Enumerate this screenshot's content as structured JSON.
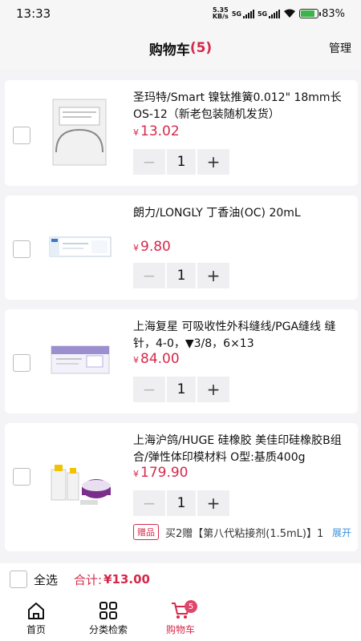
{
  "status": {
    "time": "13:33",
    "speed_value": "5.35",
    "speed_unit": "KB/s",
    "net_a": "5G",
    "net_b": "5G",
    "battery": "83%"
  },
  "header": {
    "title": "购物车",
    "count": "(5)",
    "manage": "管理"
  },
  "currency": "¥",
  "items": [
    {
      "title": "圣玛特/Smart 镍钛推簧0.012\" 18mm长OS-12（新老包装随机发货）",
      "price": "13.02",
      "qty": "1",
      "minus": "−",
      "plus": "+"
    },
    {
      "title": "朗力/LONGLY 丁香油(OC) 20mL",
      "price": "9.80",
      "qty": "1",
      "minus": "−",
      "plus": "+"
    },
    {
      "title": "上海复星 可吸收性外科缝线/PGA缝线 缝针，4-0，▼3/8，6×13",
      "price": "84.00",
      "qty": "1",
      "minus": "−",
      "plus": "+"
    },
    {
      "title": "上海沪鸽/HUGE 硅橡胶 美佳印硅橡胶B组合/弹性体印模材料 O型:基质400g",
      "price": "179.90",
      "qty": "1",
      "minus": "−",
      "plus": "+",
      "gift": {
        "badge": "赠品",
        "text": "买2赠【第八代粘接剂(1.5mL)】1",
        "expand": "展开"
      }
    }
  ],
  "footer": {
    "select_all": "全选",
    "total_label": "合计:",
    "total_value": "¥13.00"
  },
  "tabs": [
    {
      "label": "首页",
      "icon": "home-icon"
    },
    {
      "label": "分类检索",
      "icon": "grid-icon"
    },
    {
      "label": "购物车",
      "icon": "cart-icon",
      "badge": "5",
      "active": true
    }
  ],
  "colors": {
    "accent": "#d6284a",
    "link": "#3c8fd8"
  }
}
